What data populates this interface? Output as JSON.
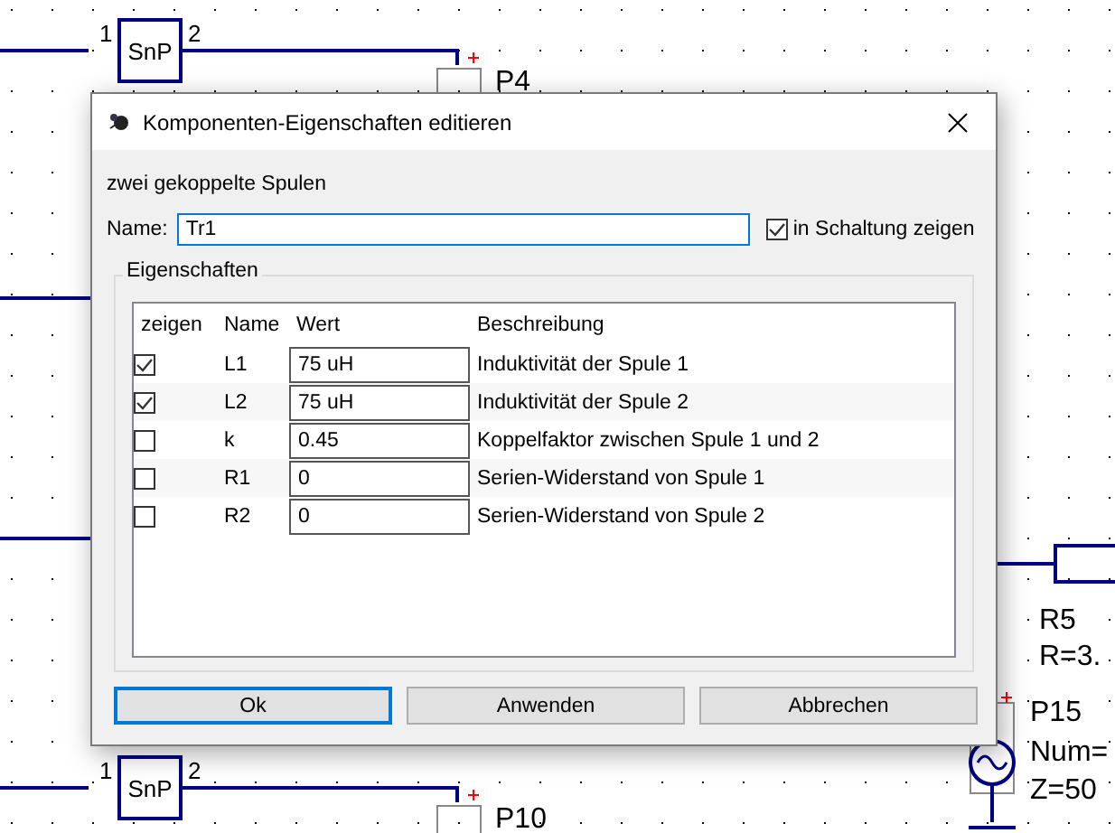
{
  "schematic": {
    "two_ports": [
      {
        "label": "SnP",
        "pin_1": "1",
        "pin_2": "2",
        "port": "P4"
      },
      {
        "label": "SnP",
        "pin_1": "1",
        "pin_2": "2",
        "port": "P10"
      }
    ],
    "resistor": {
      "name": "R5",
      "value": "R=3."
    },
    "source": {
      "name": "P15",
      "number": "Num=",
      "impedance": "Z=50"
    }
  },
  "dialog": {
    "title": "Komponenten-Eigenschaften editieren",
    "description": "zwei gekoppelte Spulen",
    "name_label": "Name:",
    "name_value": "Tr1",
    "show_in_circuit": {
      "label": "in Schaltung zeigen",
      "checked": true
    },
    "group_title": "Eigenschaften",
    "columns": [
      "zeigen",
      "Name",
      "Wert",
      "Beschreibung"
    ],
    "rows": [
      {
        "show": true,
        "name": "L1",
        "value": "75 uH",
        "description": "Induktivität der Spule 1"
      },
      {
        "show": true,
        "name": "L2",
        "value": "75 uH",
        "description": "Induktivität der Spule 2"
      },
      {
        "show": false,
        "name": "k",
        "value": "0.45",
        "description": "Koppelfaktor zwischen Spule 1 und 2"
      },
      {
        "show": false,
        "name": "R1",
        "value": "0",
        "description": "Serien-Widerstand von Spule 1"
      },
      {
        "show": false,
        "name": "R2",
        "value": "0",
        "description": "Serien-Widerstand von Spule 2"
      }
    ],
    "buttons": [
      {
        "label": "Ok",
        "focused": true
      },
      {
        "label": "Anwenden",
        "focused": false
      },
      {
        "label": "Abbrechen",
        "focused": false
      }
    ]
  }
}
